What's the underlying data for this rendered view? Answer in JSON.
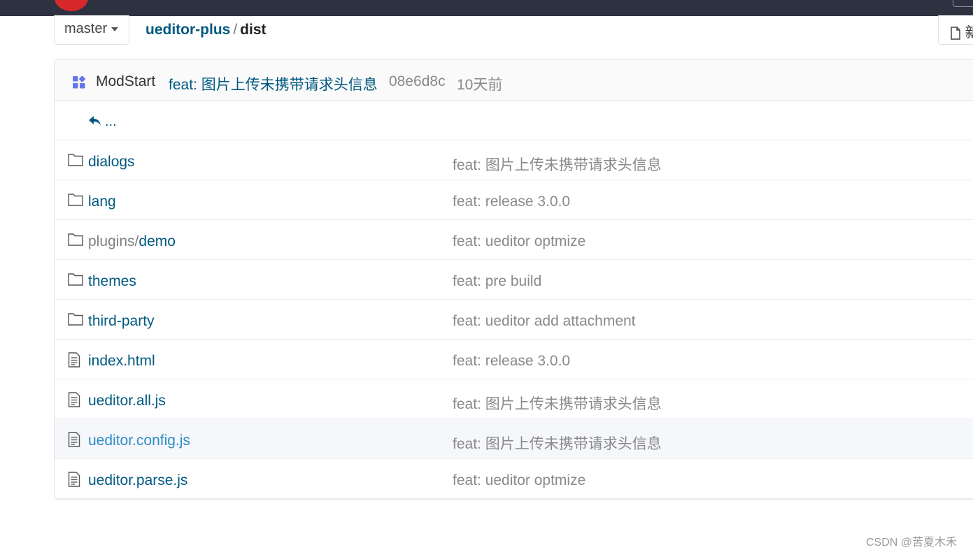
{
  "branch": {
    "label": "master"
  },
  "breadcrumb": {
    "repo": "ueditor-plus",
    "separator": "/",
    "current": "dist"
  },
  "new_button": {
    "label": "新"
  },
  "last_commit": {
    "author": "ModStart",
    "message": "feat: 图片上传未携带请求头信息",
    "hash": "08e6d8c",
    "time": "10天前"
  },
  "parent_link": {
    "label": "..."
  },
  "files": [
    {
      "type": "folder",
      "prefix": "",
      "name": "dialogs",
      "commit": "feat: 图片上传未携带请求头信息"
    },
    {
      "type": "folder",
      "prefix": "",
      "name": "lang",
      "commit": "feat: release 3.0.0"
    },
    {
      "type": "folder",
      "prefix": "plugins/",
      "name": "demo",
      "commit": "feat: ueditor optmize"
    },
    {
      "type": "folder",
      "prefix": "",
      "name": "themes",
      "commit": "feat: pre build"
    },
    {
      "type": "folder",
      "prefix": "",
      "name": "third-party",
      "commit": "feat: ueditor add attachment"
    },
    {
      "type": "file",
      "prefix": "",
      "name": "index.html",
      "commit": "feat: release 3.0.0"
    },
    {
      "type": "file",
      "prefix": "",
      "name": "ueditor.all.js",
      "commit": "feat: 图片上传未携带请求头信息"
    },
    {
      "type": "file",
      "prefix": "",
      "name": "ueditor.config.js",
      "commit": "feat: 图片上传未携带请求头信息",
      "hovered": true
    },
    {
      "type": "file",
      "prefix": "",
      "name": "ueditor.parse.js",
      "commit": "feat: ueditor optmize"
    }
  ],
  "icons": {
    "folder": "folder-icon",
    "file": "file-text-icon",
    "back": "reply-icon",
    "modstart": "grid-icon"
  },
  "colors": {
    "nav_bg": "#2e3240",
    "link": "#005980",
    "hover_link": "#2d8bc6",
    "muted": "#8a8a8a",
    "brand_red": "#d7292b",
    "modstart_icon": "#6677ee"
  },
  "watermark": "CSDN @苦夏木禾"
}
